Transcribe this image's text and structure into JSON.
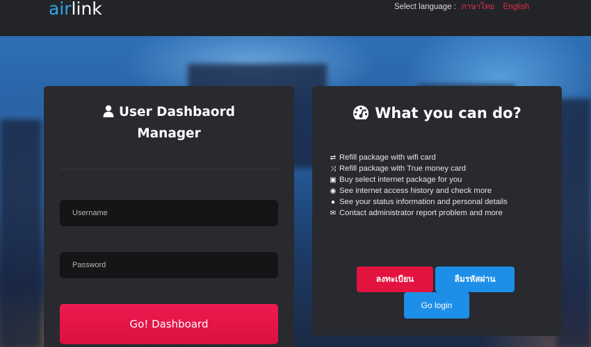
{
  "header": {
    "logo_part1": "air",
    "logo_part2": "link",
    "lang_label": "Select language :",
    "lang_thai": "ภาษาไทย",
    "lang_english": "English"
  },
  "login": {
    "title_line1": "User Dashbaord",
    "title_line2": "Manager",
    "username_placeholder": "Username",
    "password_placeholder": "Password",
    "submit_label": "Go! Dashboard"
  },
  "info": {
    "title": "What you can do?",
    "features": [
      {
        "icon": "retweet-icon",
        "text": "Refill package with wifi card"
      },
      {
        "icon": "shuffle-icon",
        "text": "Refill package with True money card"
      },
      {
        "icon": "image-icon",
        "text": "Buy select internet package for you"
      },
      {
        "icon": "eye-slash-icon",
        "text": "See internet access history and check more"
      },
      {
        "icon": "comment-icon",
        "text": "See your status information and personal details"
      },
      {
        "icon": "envelope-icon",
        "text": "Contact administrator report problem and more"
      }
    ],
    "register_label": "ลงทะเบียน",
    "forgot_label": "ลืมรหัสผ่าน",
    "login_label": "Go login"
  },
  "colors": {
    "brand_blue": "#2ea6e8",
    "accent_red": "#e2133f",
    "button_blue": "#1e8fe8"
  }
}
